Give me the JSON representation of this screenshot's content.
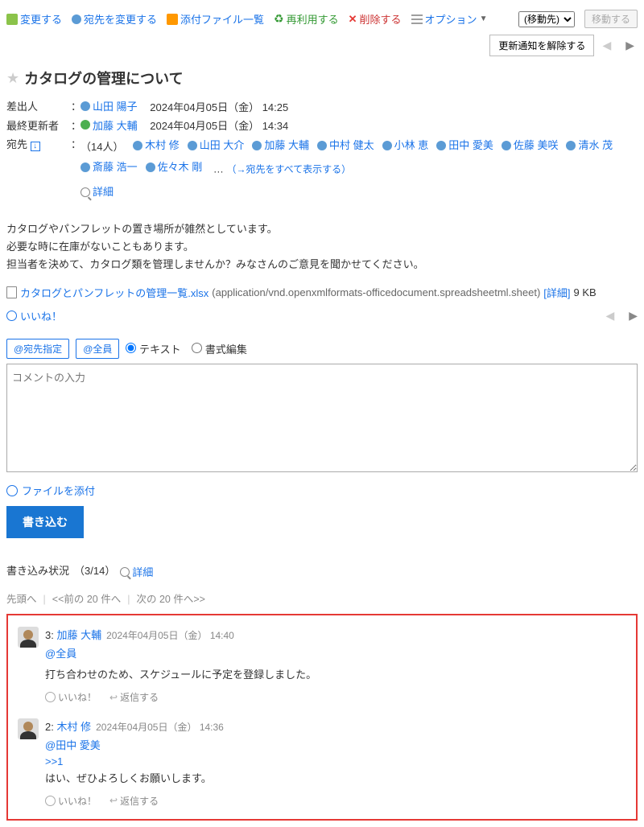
{
  "toolbar": {
    "edit": "変更する",
    "change_recipient": "宛先を変更する",
    "attachments": "添付ファイル一覧",
    "reuse": "再利用する",
    "delete": "削除する",
    "options": "オプション",
    "move_placeholder": "(移動先)",
    "move_btn": "移動する",
    "stop_notify": "更新通知を解除する"
  },
  "subject": "カタログの管理について",
  "meta": {
    "sender_label": "差出人",
    "updater_label": "最終更新者",
    "recipients_label": "宛先",
    "sender_name": "山田 陽子",
    "sender_time": "2024年04月05日（金） 14:25",
    "updater_name": "加藤 大輔",
    "updater_time": "2024年04月05日（金） 14:34",
    "recipient_count": "（14人）",
    "recipients": [
      "木村 修",
      "山田 大介",
      "加藤 大輔",
      "中村 健太",
      "小林 恵",
      "田中 愛美",
      "佐藤 美咲",
      "清水 茂",
      "斎藤 浩一",
      "佐々木 剛"
    ],
    "ellipsis": "…",
    "show_all": "（→宛先をすべて表示する）",
    "detail": "詳細"
  },
  "body": {
    "l1": "カタログやパンフレットの置き場所が雑然としています。",
    "l2": "必要な時に在庫がないこともあります。",
    "l3": "担当者を決めて、カタログ類を管理しませんか？みなさんのご意見を聞かせてください。"
  },
  "attachment": {
    "name": "カタログとパンフレットの管理一覧.xlsx",
    "mime": "(application/vnd.openxmlformats-officedocument.spreadsheetml.sheet)",
    "detail": "[詳細]",
    "size": "9 KB"
  },
  "like": "いいね！",
  "reply": {
    "at_recipient": "@宛先指定",
    "at_all": "@全員",
    "mode_text": "テキスト",
    "mode_rich": "書式編集",
    "placeholder": "コメントの入力",
    "attach": "ファイルを添付",
    "submit": "書き込む"
  },
  "status": {
    "label": "書き込み状況",
    "count": "（3/14）",
    "detail": "詳細"
  },
  "pager": {
    "top": "先頭へ",
    "prev": "<<前の 20 件へ",
    "next": "次の 20 件へ>>"
  },
  "comments": [
    {
      "num": "3:",
      "author": "加藤 大輔",
      "time": "2024年04月05日（金） 14:40",
      "mention": "@全員",
      "text": "打ち合わせのため、スケジュールに予定を登録しました。",
      "like": "いいね！",
      "reply": "返信する"
    },
    {
      "num": "2:",
      "author": "木村 修",
      "time": "2024年04月05日（金） 14:36",
      "mention": "@田中 愛美",
      "ref": ">>1",
      "text": "はい、ぜひよろしくお願いします。",
      "like": "いいね！",
      "reply": "返信する"
    }
  ]
}
